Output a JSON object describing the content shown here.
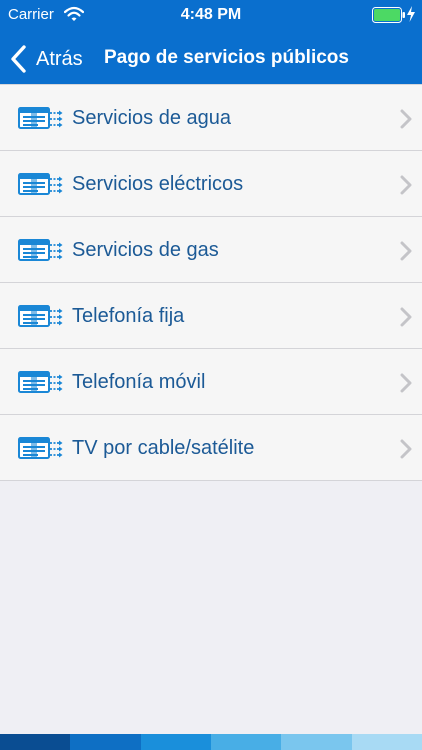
{
  "status_bar": {
    "carrier": "Carrier",
    "time": "4:48 PM",
    "icons": [
      "wifi-icon",
      "battery-icon",
      "charging-bolt-icon"
    ]
  },
  "navbar": {
    "back_label": "Atrás",
    "back_icon": "chevron-left-icon",
    "title": "Pago de servicios públicos"
  },
  "services": [
    {
      "label": "Servicios de agua",
      "icon": "bill-transfer-icon"
    },
    {
      "label": "Servicios eléctricos",
      "icon": "bill-transfer-icon"
    },
    {
      "label": "Servicios de gas",
      "icon": "bill-transfer-icon"
    },
    {
      "label": "Telefonía fija",
      "icon": "bill-transfer-icon"
    },
    {
      "label": "Telefonía móvil",
      "icon": "bill-transfer-icon"
    },
    {
      "label": "TV por cable/satélite",
      "icon": "bill-transfer-icon"
    }
  ],
  "colors": {
    "brand_blue": "#0a6fce",
    "label_blue": "#1c5a96",
    "icon_blue": "#1a87d6",
    "chevron_gray": "#c4c4c8",
    "background": "#efeff4",
    "strip": [
      "#0a4d92",
      "#0e6fc4",
      "#1a8fdb",
      "#48aee6",
      "#7ac6ee",
      "#a8daf4"
    ]
  }
}
